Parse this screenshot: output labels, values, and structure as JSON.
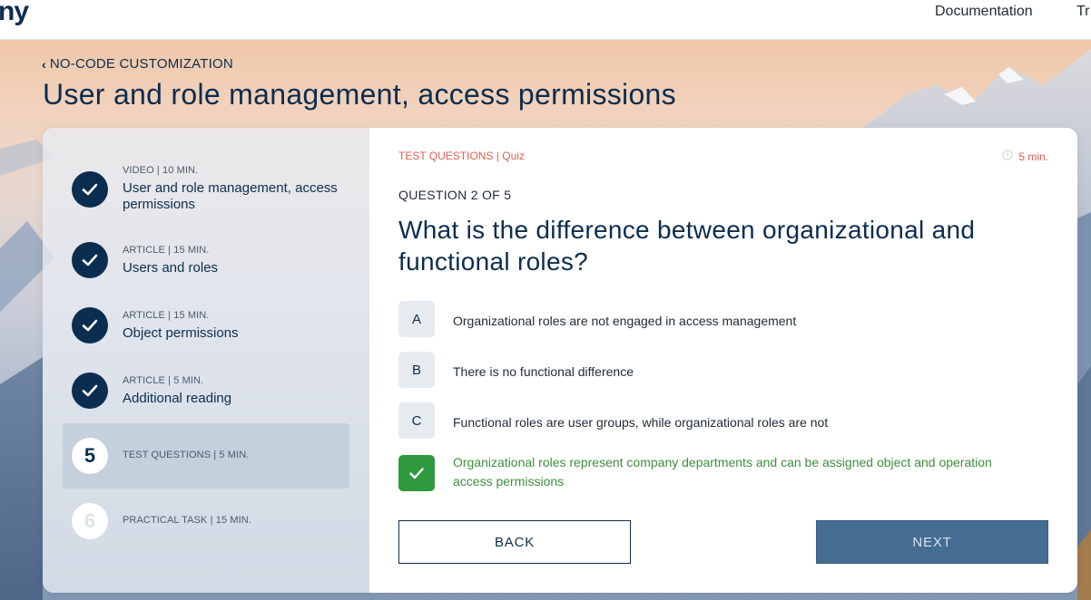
{
  "topbar": {
    "logo": "ny",
    "nav": [
      "Documentation",
      "Tr"
    ]
  },
  "breadcrumb": {
    "label": "NO-CODE CUSTOMIZATION"
  },
  "page": {
    "title": "User and role management, access permissions"
  },
  "steps": [
    {
      "meta": "VIDEO | 10 MIN.",
      "title": "User and role management, access permissions",
      "state": "done"
    },
    {
      "meta": "ARTICLE | 15 MIN.",
      "title": "Users and roles",
      "state": "done"
    },
    {
      "meta": "ARTICLE | 15 MIN.",
      "title": "Object permissions",
      "state": "done"
    },
    {
      "meta": "ARTICLE | 5 MIN.",
      "title": "Additional reading",
      "state": "done"
    },
    {
      "number": "5",
      "meta": "TEST QUESTIONS | 5 MIN.",
      "state": "current"
    },
    {
      "number": "6",
      "meta": "PRACTICAL TASK | 15 MIN.",
      "state": "future"
    }
  ],
  "quiz": {
    "label": "TEST QUESTIONS | Quiz",
    "time": "5 min.",
    "counter": "QUESTION 2 OF 5",
    "question": "What is the difference between organizational and functional roles?",
    "options": [
      {
        "letter": "A",
        "text": "Organizational roles are not engaged in access management"
      },
      {
        "letter": "B",
        "text": "There is no functional difference"
      },
      {
        "letter": "C",
        "text": "Functional roles are user groups, while organizational roles are not"
      },
      {
        "letter": "",
        "text": "Organizational roles represent company departments and can be assigned object and operation access permissions",
        "correct": true
      }
    ],
    "back_label": "BACK",
    "next_label": "NEXT"
  },
  "colors": {
    "brand": "#0b2d4f",
    "accent_red": "#e45c50",
    "correct_green": "#2e9a3d",
    "next_button": "#456c92"
  },
  "icons": {
    "step_done": "check-icon",
    "time": "clock-icon",
    "back_nav": "chevron-left-icon"
  }
}
